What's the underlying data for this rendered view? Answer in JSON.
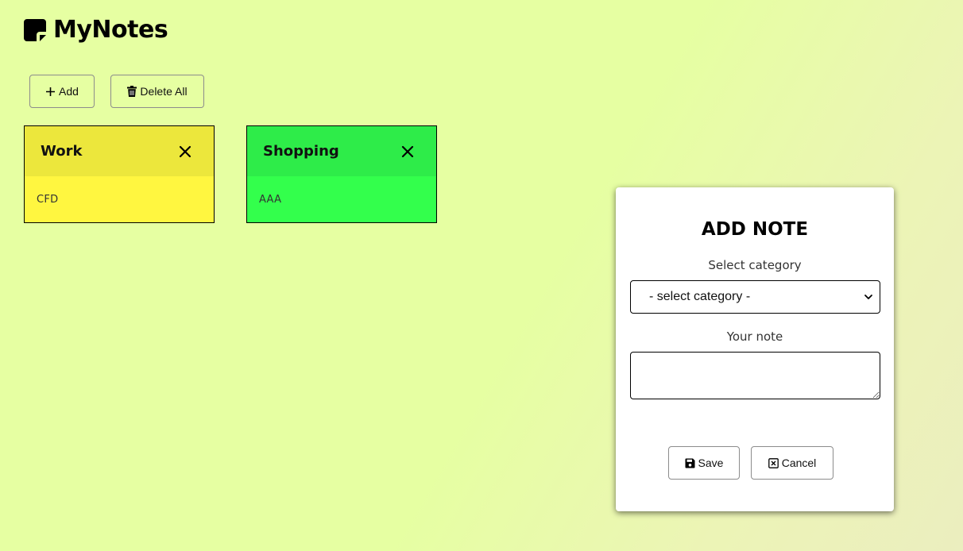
{
  "app": {
    "title": "MyNotes",
    "logo_icon": "sticky-note-icon"
  },
  "toolbar": {
    "add_label": "Add",
    "add_icon": "plus-icon",
    "delete_all_label": "Delete All",
    "delete_all_icon": "trash-icon"
  },
  "notes": [
    {
      "category": "Work",
      "text": "CFD",
      "header_color": "#ece73c",
      "body_color": "#fff640",
      "close_icon": "close-icon"
    },
    {
      "category": "Shopping",
      "text": "AAA",
      "header_color": "#2eec49",
      "body_color": "#33ff4c",
      "close_icon": "close-icon"
    }
  ],
  "modal": {
    "title": "ADD NOTE",
    "category_label": "Select category",
    "category_select": {
      "selected": "- select category -"
    },
    "note_label": "Your note",
    "note_value": "",
    "save_label": "Save",
    "save_icon": "floppy-disk-icon",
    "cancel_label": "Cancel",
    "cancel_icon": "x-square-icon"
  },
  "colors": {
    "background": "#e6ffa2",
    "modal_background": "#ffffff"
  }
}
